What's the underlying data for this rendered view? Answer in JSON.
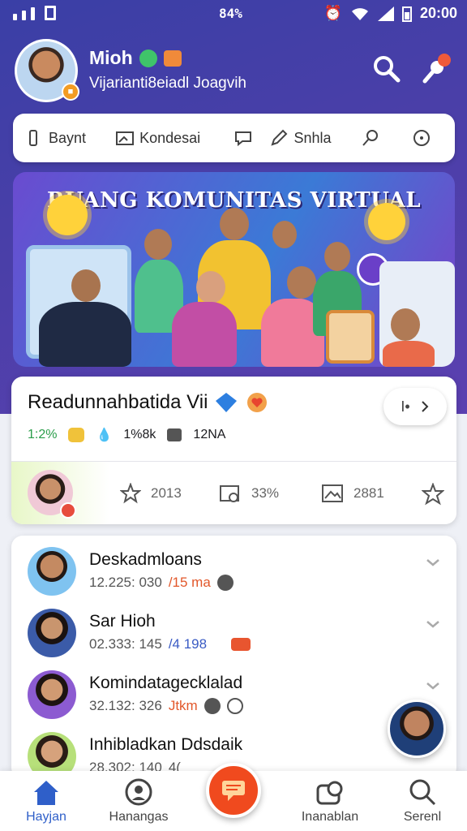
{
  "status_bar": {
    "center": "84%",
    "time": "20:00"
  },
  "profile": {
    "name": "Mioh",
    "subtitle": "Vijarianti8eiadl Joagvih"
  },
  "toolbar": {
    "items": [
      {
        "label": "Baynt",
        "icon": "phone-icon"
      },
      {
        "label": "Kondesai",
        "icon": "image-icon"
      },
      {
        "label": "",
        "icon": "chat-bubble-icon"
      },
      {
        "label": "Snhla",
        "icon": "pencil-icon"
      },
      {
        "label": "",
        "icon": "search-small-icon"
      },
      {
        "label": "",
        "icon": "circle-info-icon"
      }
    ]
  },
  "banner": {
    "title": "RUANG KOMUNITAS VIRTUAL"
  },
  "feature_card": {
    "title": "Readunnahbatida Vii",
    "stats": [
      {
        "value": "1:2%",
        "color": "#2a9d4a"
      },
      {
        "value": "1%8k",
        "color": "#555555"
      },
      {
        "value": "12NA",
        "color": "#555555"
      }
    ],
    "pill_label": "I•",
    "actions": [
      {
        "icon": "star-icon",
        "value": "2013"
      },
      {
        "icon": "folder-clock-icon",
        "value": "33%"
      },
      {
        "icon": "picture-icon",
        "value": "2881"
      },
      {
        "icon": "star-check-icon",
        "value": ""
      }
    ]
  },
  "list": {
    "rows": [
      {
        "name": "Deskadmloans",
        "meta": "12.225: 030",
        "highlight": "/15 ma",
        "avatar_color": "#7fc3f0"
      },
      {
        "name": "Sar Hioh",
        "meta": "02.333: 145",
        "highlight": "/4 198",
        "avatar_color": "#3b5ba8"
      },
      {
        "name": "Komindatagecklalad",
        "meta": "32.132: 326",
        "highlight": "Jtkm",
        "avatar_color": "#8c5bd1"
      },
      {
        "name": "Inhibladkan Ddsdaik",
        "meta": "28.302: 140",
        "highlight": "4(",
        "avatar_color": "#b7e07a"
      }
    ]
  },
  "nav": {
    "items": [
      {
        "label": "Hayjan",
        "icon": "home-icon",
        "active": true
      },
      {
        "label": "Hanangas",
        "icon": "face-icon",
        "active": false
      },
      {
        "label": "Inanablan",
        "icon": "camera-icon",
        "active": false
      },
      {
        "label": "Serenl",
        "icon": "search-icon",
        "active": false
      }
    ]
  }
}
